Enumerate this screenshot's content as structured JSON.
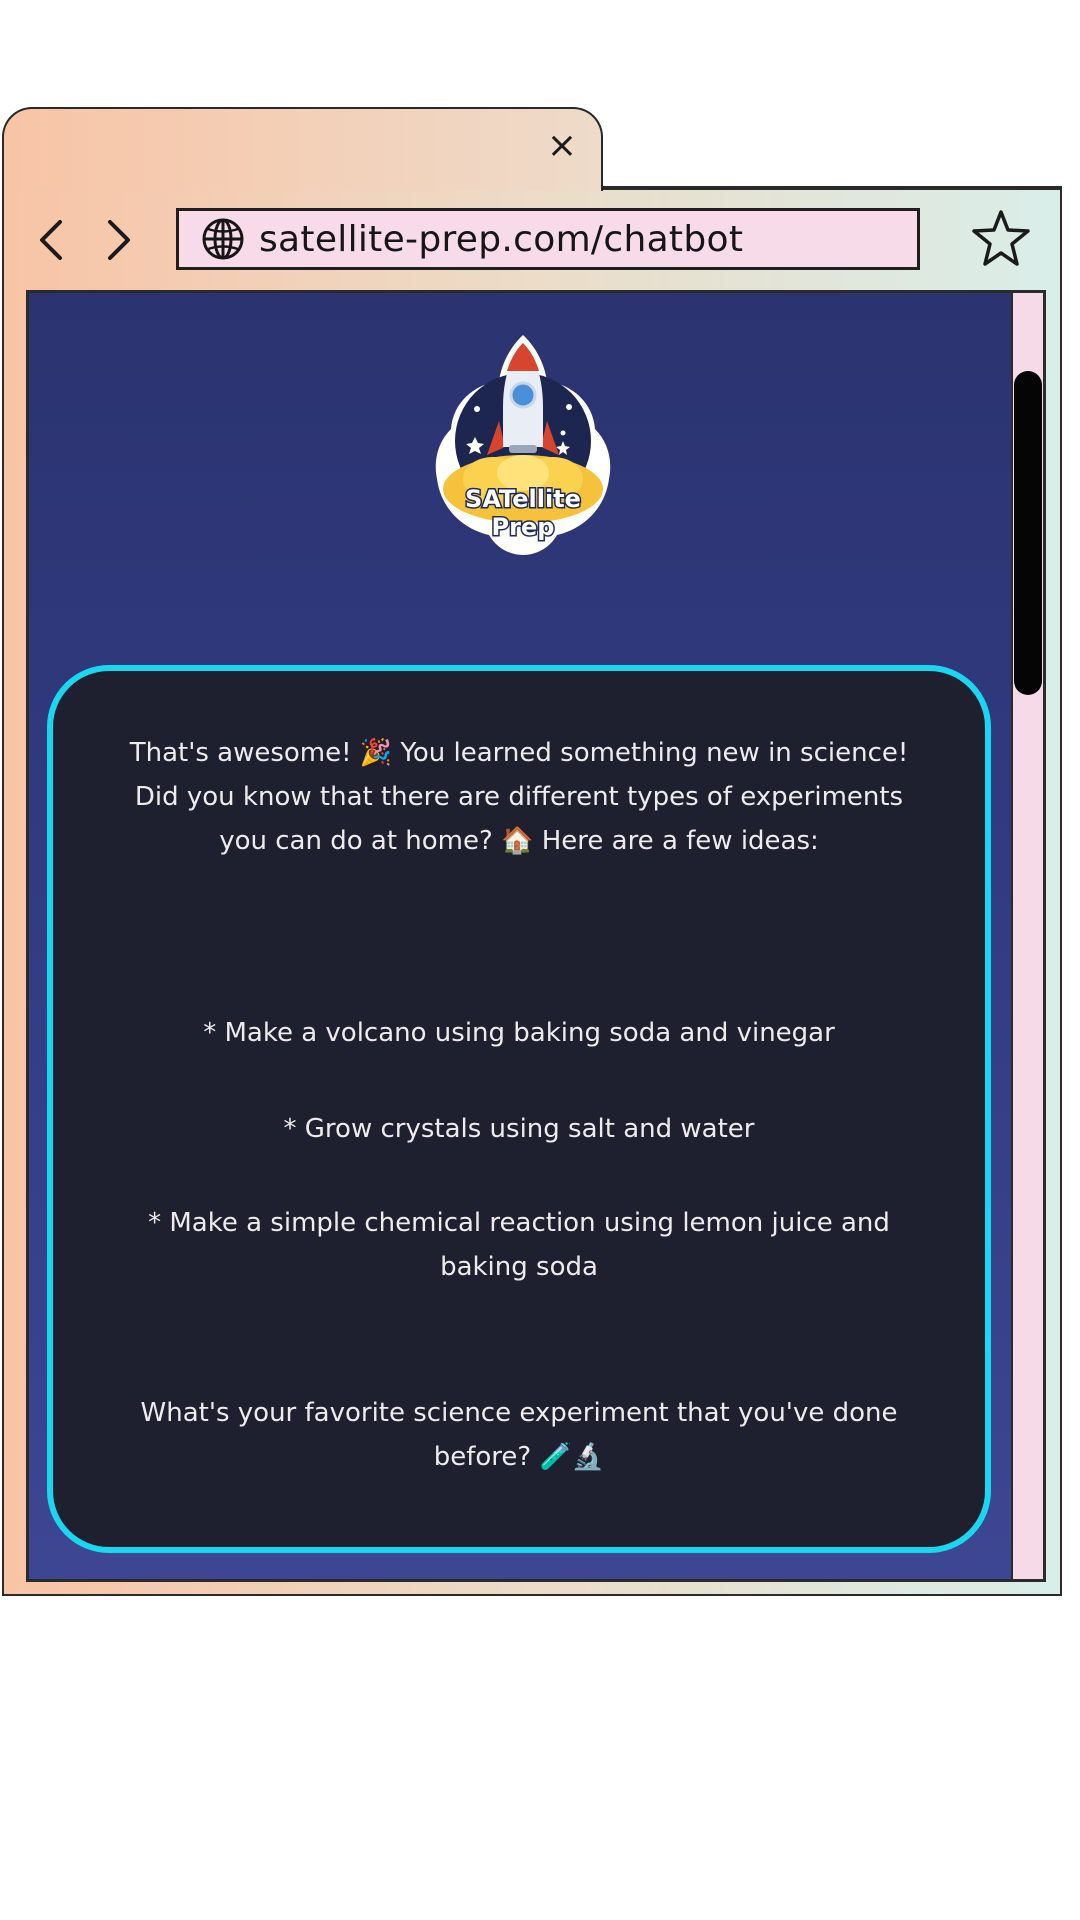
{
  "browser": {
    "tab_close_glyph": "×",
    "url": "satellite-prep.com/chatbot",
    "frame_gradient": [
      "#f8c4a6",
      "#d9eee9"
    ],
    "address_bar_color": "#f7dbe8"
  },
  "logo": {
    "line1": "SATellite",
    "line2": "Prep"
  },
  "message": {
    "intro": "That's awesome! 🎉 You learned something new in science! Did you know that there are different types of experiments you can do at home? 🏠 Here are a few ideas:",
    "ideas": [
      "* Make a volcano using baking soda and vinegar",
      "* Grow crystals using salt and water",
      "* Make a simple chemical reaction using lemon juice and baking soda"
    ],
    "question": "What's your favorite science experiment that you've done before? 🧪🔬",
    "card_border_color": "#1ad6ee",
    "card_bg_color": "#1e2030"
  },
  "page_bg_color": "#2f377a"
}
